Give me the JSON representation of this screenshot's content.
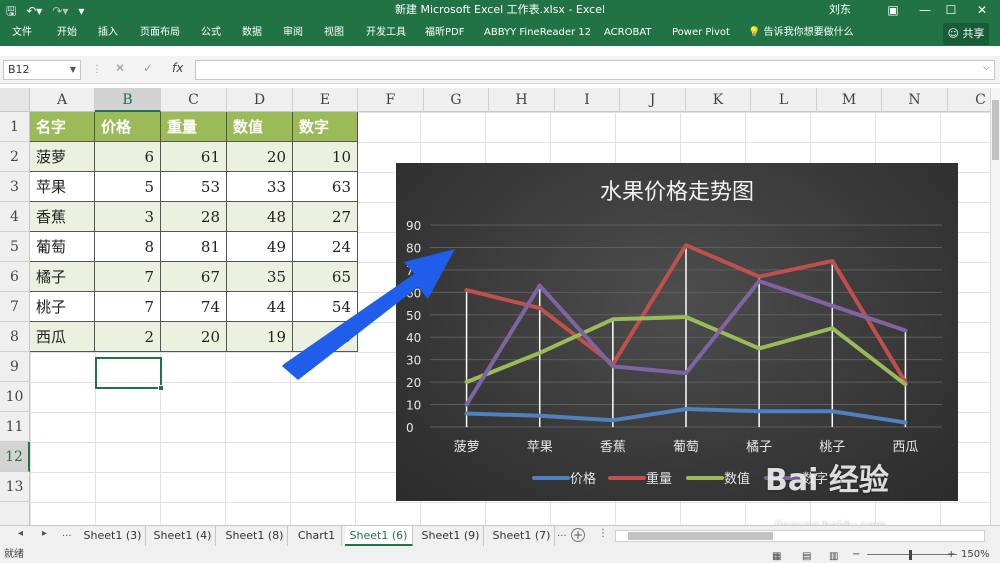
{
  "titlebar": {
    "title": "新建 Microsoft Excel 工作表.xlsx  -  Excel",
    "user": "刘东",
    "qat": [
      "save-icon",
      "undo-icon",
      "redo-icon",
      "customize-icon"
    ],
    "bg": "#217346"
  },
  "ribbon": {
    "tabs": [
      "文件",
      "开始",
      "插入",
      "页面布局",
      "公式",
      "数据",
      "审阅",
      "视图",
      "开发工具",
      "福昕PDF",
      "ABBYY FineReader 12",
      "ACROBAT",
      "Power Pivot",
      "告诉我你想要做什么"
    ],
    "share": "共享"
  },
  "formula_bar": {
    "name_box": "B12",
    "fx": "fx",
    "value": ""
  },
  "columns": [
    "A",
    "B",
    "C",
    "D",
    "E",
    "F",
    "G",
    "H",
    "I",
    "J",
    "K",
    "L",
    "M",
    "N",
    "C"
  ],
  "rows": [
    "1",
    "2",
    "3",
    "4",
    "5",
    "6",
    "7",
    "8",
    "9",
    "10",
    "11",
    "12",
    "13"
  ],
  "table": {
    "headers": [
      "名字",
      "价格",
      "重量",
      "数值",
      "数字"
    ],
    "rows": [
      [
        "菠萝",
        "6",
        "61",
        "20",
        "10"
      ],
      [
        "苹果",
        "5",
        "53",
        "33",
        "63"
      ],
      [
        "香蕉",
        "3",
        "28",
        "48",
        "27"
      ],
      [
        "葡萄",
        "8",
        "81",
        "49",
        "24"
      ],
      [
        "橘子",
        "7",
        "67",
        "35",
        "65"
      ],
      [
        "桃子",
        "7",
        "74",
        "44",
        "54"
      ],
      [
        "西瓜",
        "2",
        "20",
        "19",
        "43"
      ]
    ],
    "header_color": "#9bbb59",
    "band_color": "#ebf1de"
  },
  "chart_data": {
    "type": "line",
    "title": "水果价格走势图",
    "categories": [
      "菠萝",
      "苹果",
      "香蕉",
      "葡萄",
      "橘子",
      "桃子",
      "西瓜"
    ],
    "series": [
      {
        "name": "价格",
        "values": [
          6,
          5,
          3,
          8,
          7,
          7,
          2
        ],
        "color": "#4f81bd"
      },
      {
        "name": "重量",
        "values": [
          61,
          53,
          28,
          81,
          67,
          74,
          20
        ],
        "color": "#c0504d"
      },
      {
        "name": "数值",
        "values": [
          20,
          33,
          48,
          49,
          35,
          44,
          19
        ],
        "color": "#9bbb59"
      },
      {
        "name": "数字",
        "values": [
          10,
          63,
          27,
          24,
          65,
          54,
          43
        ],
        "color": "#8064a2"
      }
    ],
    "ylim": [
      0,
      90
    ],
    "yticks": [
      "0",
      "10",
      "20",
      "30",
      "40",
      "50",
      "60",
      "70",
      "80",
      "90"
    ],
    "grid": true,
    "drop_lines": true,
    "legend": "bottom",
    "background": "#3a3a3a"
  },
  "sheets": {
    "nav": [
      "prev-sheet-icon",
      "next-sheet-icon"
    ],
    "ellipsis": "...",
    "tabs": [
      "Sheet1 (3)",
      "Sheet1 (4)",
      "Sheet1 (8)",
      "Chart1",
      "Sheet1 (6)",
      "Sheet1 (9)",
      "Sheet1 (7)",
      "..."
    ],
    "active": "Sheet1 (6)"
  },
  "status": {
    "ready": "就绪",
    "zoom": "150%"
  },
  "watermark": {
    "text": "Bai 经验",
    "url": "jingyan.baidu.com"
  }
}
